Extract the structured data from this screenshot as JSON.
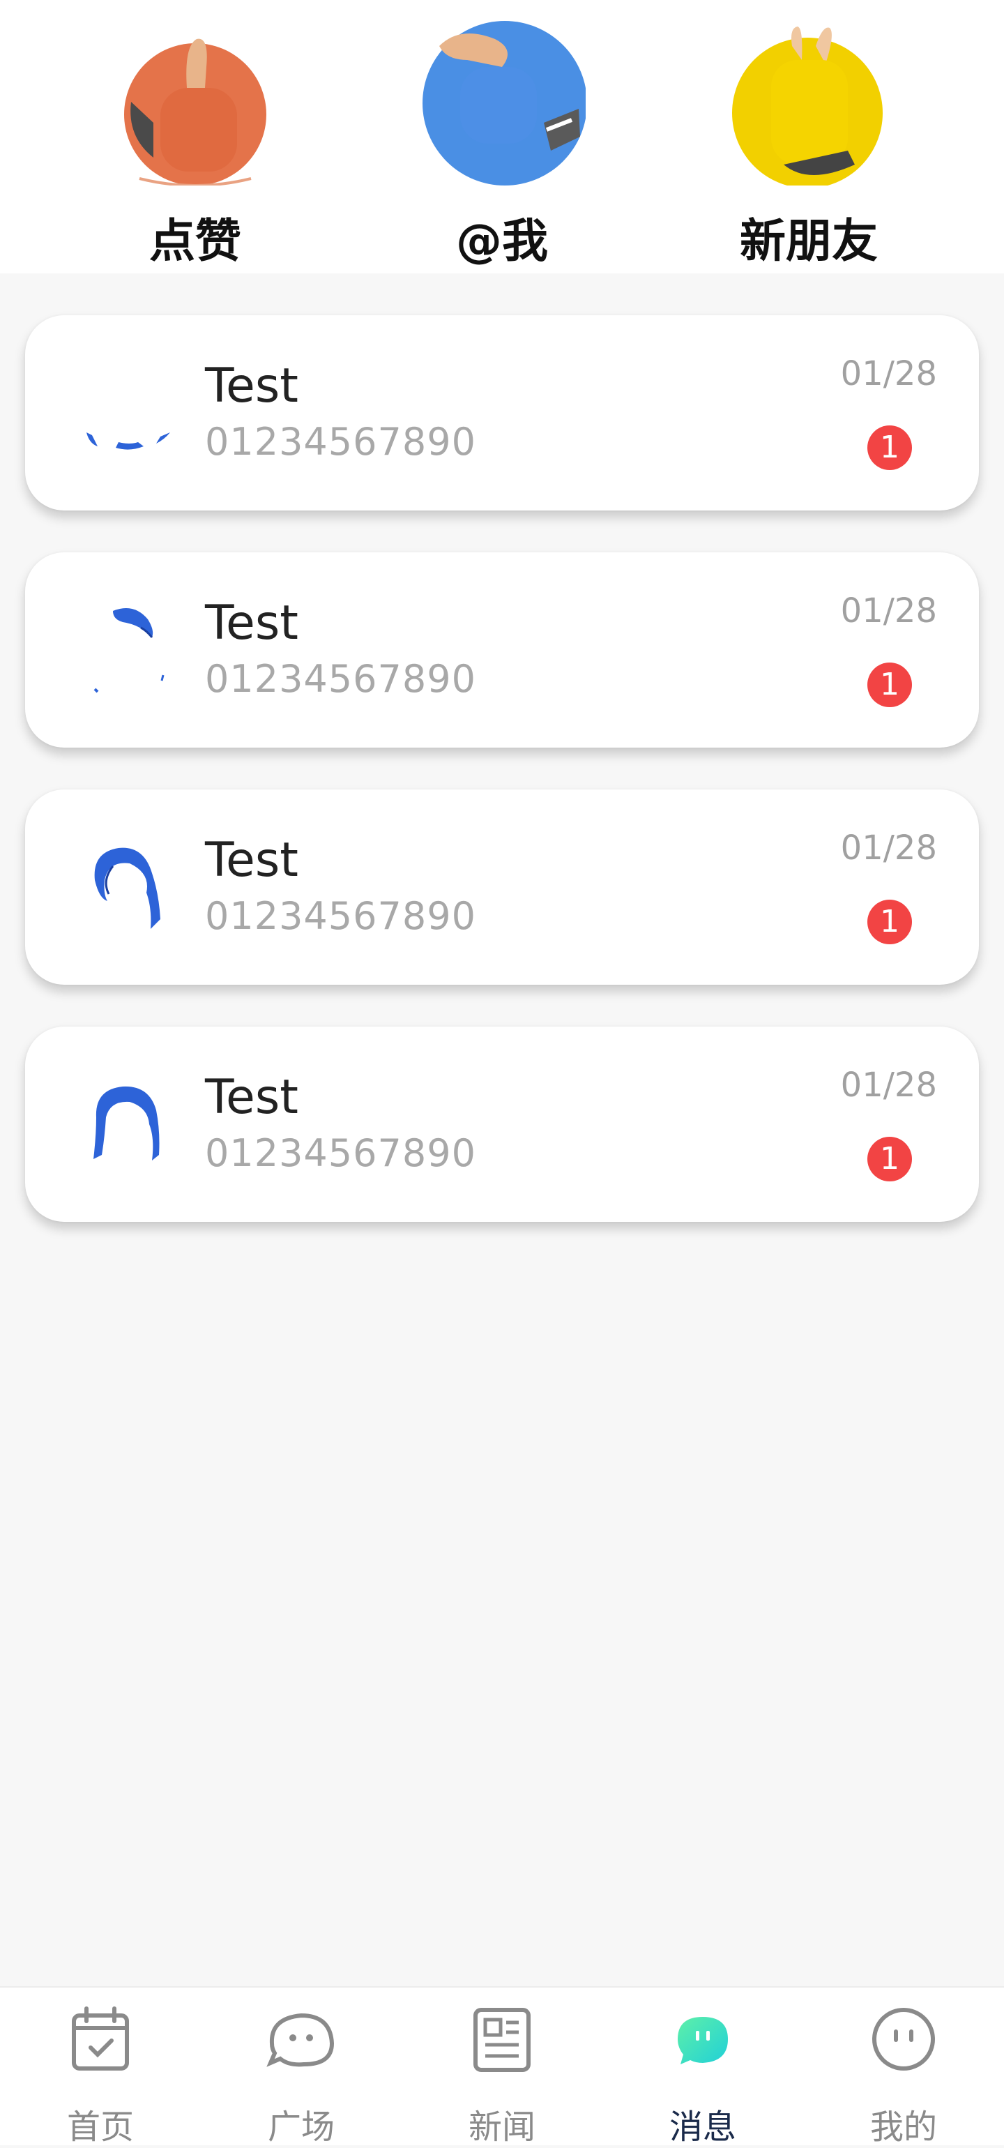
{
  "quick_actions": [
    {
      "label": "点赞",
      "icon": "thumbs-up-icon",
      "color": "#e4734a"
    },
    {
      "label": "@我",
      "icon": "at-me-icon",
      "color": "#4a8fe4"
    },
    {
      "label": "新朋友",
      "icon": "new-friend-icon",
      "color": "#f2d000"
    }
  ],
  "messages": [
    {
      "name": "Test",
      "preview": "01234567890",
      "date": "01/28",
      "unread": "1"
    },
    {
      "name": "Test",
      "preview": "01234567890",
      "date": "01/28",
      "unread": "1"
    },
    {
      "name": "Test",
      "preview": "01234567890",
      "date": "01/28",
      "unread": "1"
    },
    {
      "name": "Test",
      "preview": "01234567890",
      "date": "01/28",
      "unread": "1"
    }
  ],
  "tabbar": {
    "active": "消息",
    "tabs": [
      {
        "label": "首页",
        "icon": "calendar-icon"
      },
      {
        "label": "广场",
        "icon": "chat-bubble-icon"
      },
      {
        "label": "新闻",
        "icon": "newspaper-icon"
      },
      {
        "label": "消息",
        "icon": "message-icon"
      },
      {
        "label": "我的",
        "icon": "profile-face-icon"
      }
    ]
  },
  "colors": {
    "badge": "#f24444",
    "active_tab_icon": "#3de0c8",
    "avatar_blue": "#2d63d8"
  }
}
